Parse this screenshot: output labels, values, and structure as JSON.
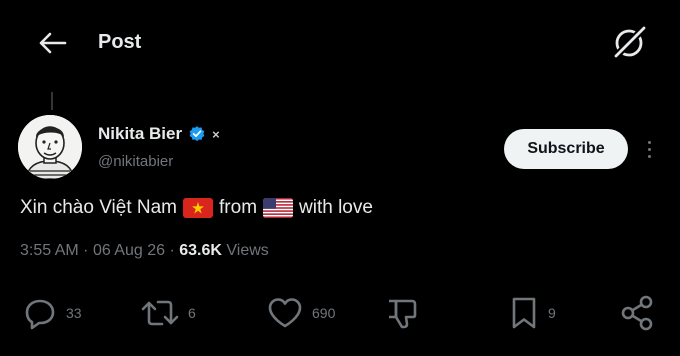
{
  "header": {
    "title": "Post"
  },
  "author": {
    "display_name": "Nikita Bier",
    "handle": "@nikitabier",
    "affiliation_glyph": "×"
  },
  "follow": {
    "subscribe_label": "Subscribe"
  },
  "tweet": {
    "text_part1": "Xin chào Việt Nam",
    "text_from": "from",
    "text_end": "with love",
    "flags": [
      "vietnam-flag",
      "usa-flag"
    ]
  },
  "meta": {
    "time": "3:55 AM",
    "separator": "·",
    "date": "06 Aug 26",
    "views_count": "63.6K",
    "views_label": "Views"
  },
  "actions": {
    "replies": "33",
    "reposts": "6",
    "likes": "690",
    "bookmarks": "9"
  },
  "colors": {
    "background": "#000000",
    "text": "#e7e9ea",
    "muted": "#71767b",
    "verified": "#1d9bf0",
    "button_bg": "#eff3f4"
  },
  "icons": [
    "back-arrow-icon",
    "grok-icon",
    "verified-badge-icon",
    "reply-icon",
    "repost-icon",
    "like-icon",
    "dislike-icon",
    "bookmark-icon",
    "share-icon"
  ]
}
